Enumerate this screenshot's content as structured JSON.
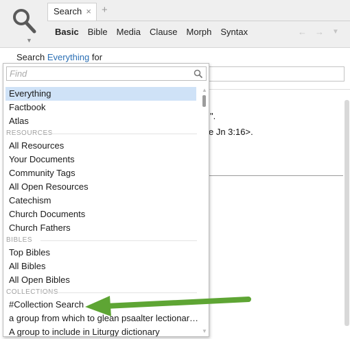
{
  "tab": {
    "label": "Search",
    "close": "×",
    "new_tab": "+"
  },
  "modes": [
    "Basic",
    "Bible",
    "Media",
    "Clause",
    "Morph",
    "Syntax"
  ],
  "active_mode": "Basic",
  "nav": {
    "back": "←",
    "forward": "→",
    "menu": "▼"
  },
  "search_line": {
    "prefix": "Search ",
    "scope": "Everything",
    "suffix": " for"
  },
  "results": {
    "line1": "\".",
    "line2": "e Jn 3:16>."
  },
  "dropdown": {
    "find_placeholder": "Find",
    "top_items": [
      "Everything",
      "Factbook",
      "Atlas"
    ],
    "sections": [
      {
        "header": "RESOURCES",
        "items": [
          "All Resources",
          "Your Documents",
          "Community Tags",
          "All Open Resources",
          "Catechism",
          "Church Documents",
          "Church Fathers"
        ]
      },
      {
        "header": "BIBLES",
        "items": [
          "Top Bibles",
          "All Bibles",
          "All Open Bibles"
        ]
      },
      {
        "header": "COLLECTIONS",
        "items": [
          "#Collection Search",
          "a group from which to glean psaalter lectionar…",
          "A group to include in Liturgy dictionary"
        ]
      }
    ]
  },
  "colors": {
    "accent": "#2a6fb5",
    "selection": "#cfe2f7",
    "arrow": "#5ea534"
  }
}
